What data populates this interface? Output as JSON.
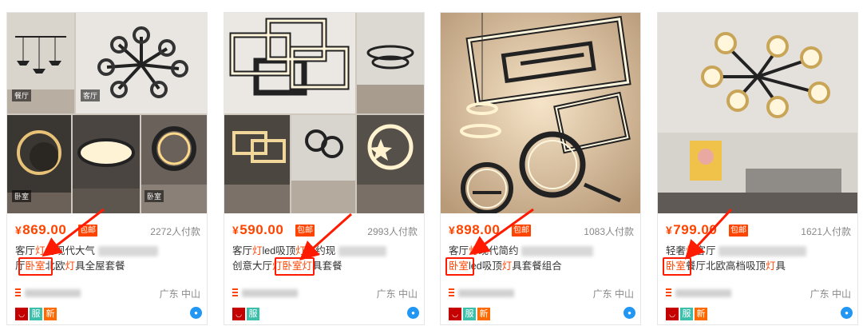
{
  "colors": {
    "accent": "#ff4400",
    "annotation": "#ff1a00",
    "sold_text": "#888888"
  },
  "products": [
    {
      "image_tags": [
        "餐厅",
        "客厅",
        "卧室",
        "卧室"
      ],
      "currency": "¥",
      "price": "869.00",
      "free_shipping": "包邮",
      "sold": "2272人付款",
      "title_line1_a": "客厅",
      "title_line1_b": "灯",
      "title_line1_c": "约现代大气",
      "title_line2_a": "厅",
      "title_line2_b": "卧室",
      "title_line2_c": "北欧",
      "title_line2_d": "灯",
      "title_line2_e": "具全屋套餐",
      "location": "广东 中山",
      "badges": [
        "tmall-icon",
        "服",
        "新"
      ]
    },
    {
      "image_tags": [],
      "currency": "¥",
      "price": "590.00",
      "free_shipping": "包邮",
      "sold": "2993人付款",
      "title_line1_a": "客厅",
      "title_line1_b": "灯",
      "title_line1_c": "led吸顶",
      "title_line1_d": "灯",
      "title_line1_e": "简约现",
      "title_line2_a": "创意大厅",
      "title_line2_b": "灯",
      "title_line2_c": "卧室",
      "title_line2_d": "灯",
      "title_line2_e": "具套餐",
      "location": "广东 中山",
      "badges": [
        "tmall-icon",
        "服"
      ]
    },
    {
      "image_tags": [],
      "currency": "¥",
      "price": "898.00",
      "free_shipping": "包邮",
      "sold": "1083人付款",
      "title_line1_a": "客厅",
      "title_line1_b": "灯",
      "title_line1_c": "现代简约",
      "title_line2_a": "卧室",
      "title_line2_b": "led吸顶",
      "title_line2_c": "灯",
      "title_line2_d": "具套餐组合",
      "location": "广东 中山",
      "badges": [
        "tmall-icon",
        "服",
        "新"
      ]
    },
    {
      "image_tags": [],
      "currency": "¥",
      "price": "799.00",
      "free_shipping": "包邮",
      "sold": "1621人付款",
      "title_line1_a": "轻奢",
      "title_line1_b": "灯",
      "title_line1_c": "客厅",
      "title_line2_a": "卧室",
      "title_line2_b": "餐厅北欧高档吸顶",
      "title_line2_c": "灯",
      "title_line2_d": "具",
      "location": "广东 中山",
      "badges": [
        "tmall-icon",
        "服",
        "新"
      ]
    }
  ]
}
